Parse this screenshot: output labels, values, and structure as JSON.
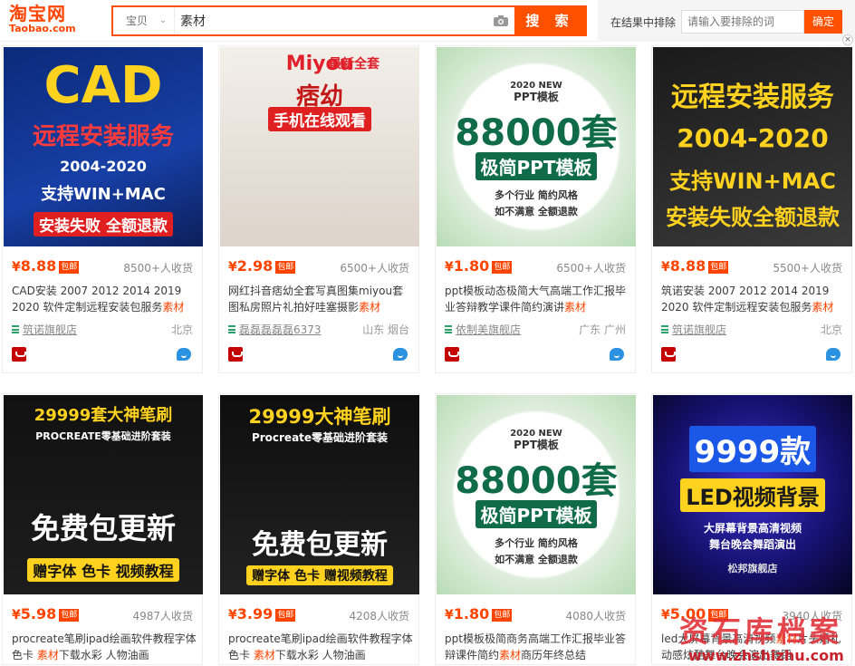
{
  "logo": {
    "cn": "淘宝网",
    "en": "Taobao.com"
  },
  "search": {
    "category": "宝贝",
    "query": "素材",
    "button": "搜 索"
  },
  "exclude": {
    "label": "在结果中排除",
    "placeholder": "请输入要排除的词",
    "button": "确定"
  },
  "colors": {
    "brand": "#ff5000",
    "price": "#ff4400",
    "shop_icon": "#2ba36b"
  },
  "products": [
    {
      "price": "8.88",
      "badge": "包邮",
      "sales": "8500+人收货",
      "title_a": "CAD安装 2007 2012 2014 2019 2020 软件定制远程安装包服务",
      "title_hl": "素材",
      "title_b": "",
      "shop": "筑诺旗舰店",
      "location": "北京",
      "poster": [
        "CAD",
        "远程安装服务",
        "2004-2020",
        "支持WIN+MAC",
        "安装失败 全额退款"
      ]
    },
    {
      "price": "2.98",
      "badge": "包邮",
      "sales": "6500+人收货",
      "title_a": "网红抖音痞幼全套写真图集miyou套图私房照片礼拍好哇塞摄影",
      "title_hl": "素材",
      "title_b": "",
      "shop": "磊磊磊磊磊6373",
      "location": "山东 烟台",
      "poster": [
        "Miyou",
        "痞幼",
        "最新全套",
        "手机在线观看"
      ]
    },
    {
      "price": "1.80",
      "badge": "包邮",
      "sales": "6500+人收货",
      "title_a": "ppt模板动态极简大气高端工作汇报毕业答辩教学课件简约演讲",
      "title_hl": "素材",
      "title_b": "",
      "shop": "依制美旗舰店",
      "location": "广东 广州",
      "poster": [
        "2020 NEW",
        "PPT模板",
        "88000套",
        "极简PPT模板",
        "多个行业 简约风格",
        "如不满意 全额退款"
      ]
    },
    {
      "price": "8.88",
      "badge": "包邮",
      "sales": "5500+人收货",
      "title_a": "筑诺安装 2007 2012 2014 2019 2020 软件定制远程安装包服务",
      "title_hl": "素材",
      "title_b": "",
      "shop": "筑诺旗舰店",
      "location": "北京",
      "poster": [
        "远程安装服务",
        "2004-2020",
        "支持WIN+MAC",
        "安装失败全额退款"
      ]
    },
    {
      "price": "5.98",
      "badge": "包邮",
      "sales": "4987人收货",
      "title_a": "procreate笔刷ipad绘画软件教程字体色卡 ",
      "title_hl": "素材",
      "title_b": "下载水彩 人物油画",
      "shop": "",
      "location": "",
      "poster": [
        "29999套大神笔刷",
        "PROCREATE零基础进阶套装",
        "免费包更新",
        "赠字体 色卡 视频教程"
      ]
    },
    {
      "price": "3.99",
      "badge": "包邮",
      "sales": "4208人收货",
      "title_a": "procreate笔刷ipad绘画软件教程字体色卡 ",
      "title_hl": "素材",
      "title_b": "下载水彩 人物油画",
      "shop": "",
      "location": "",
      "poster": [
        "29999大神笔刷",
        "Procreate零基础进阶套装",
        "免费包更新",
        "赠字体 色卡 赠视频教程"
      ]
    },
    {
      "price": "1.80",
      "badge": "包邮",
      "sales": "4080人收货",
      "title_a": "ppt模板极简商务高端工作汇报毕业答辩课件简约",
      "title_hl": "素材",
      "title_b": "商历年终总结",
      "shop": "",
      "location": "",
      "poster": [
        "2020 NEW",
        "PPT模板",
        "88000套",
        "极简PPT模板",
        "多个行业 简约风格",
        "如不满意 全额退款"
      ]
    },
    {
      "price": "5.00",
      "badge": "包邮",
      "sales": "3940人收货",
      "title_a": "led大屏幕背景高清视频",
      "title_hl": "素材",
      "title_b": "片头婚礼动感炫酷舞台晚会演出舞蹈",
      "shop": "",
      "location": "",
      "poster": [
        "9999款",
        "LED视频背景",
        "大屏幕背景高清视频",
        "舞台晚会舞蹈演出",
        "松邦旗舰店"
      ]
    }
  ],
  "watermark": {
    "text": "资石库档案",
    "url": "www.zhshizhu.com"
  }
}
